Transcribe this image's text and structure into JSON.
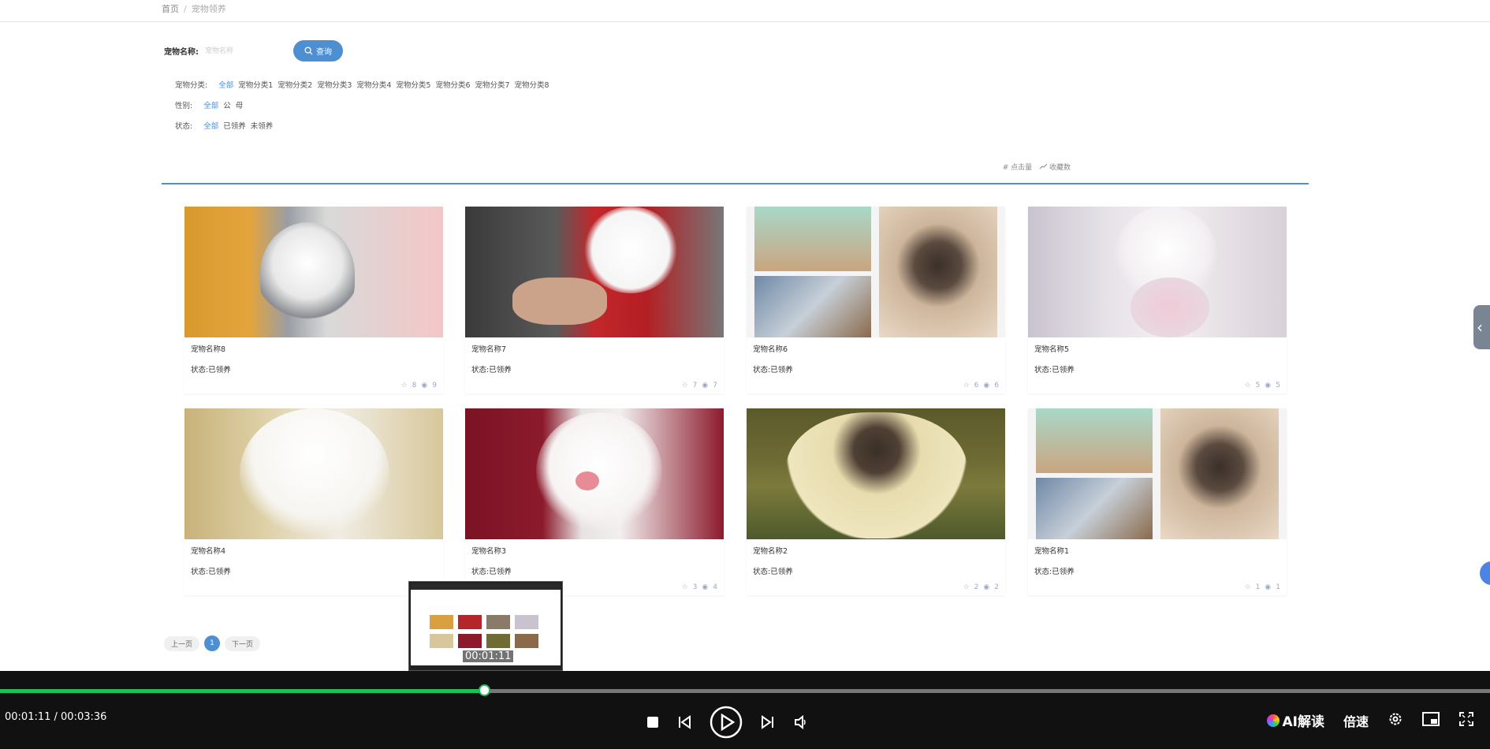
{
  "breadcrumb": {
    "home": "首页",
    "sep": "/",
    "current": "宠物领养"
  },
  "search": {
    "label": "宠物名称:",
    "placeholder": "宠物名称",
    "button": "查询"
  },
  "filters": {
    "category": {
      "label": "宠物分类:",
      "options": [
        "全部",
        "宠物分类1",
        "宠物分类2",
        "宠物分类3",
        "宠物分类4",
        "宠物分类5",
        "宠物分类6",
        "宠物分类7",
        "宠物分类8"
      ]
    },
    "gender": {
      "label": "性别:",
      "options": [
        "全部",
        "公",
        "母"
      ]
    },
    "status": {
      "label": "状态:",
      "options": [
        "全部",
        "已领养",
        "未领养"
      ]
    }
  },
  "sort": {
    "clicks": "# 点击量",
    "favorites": "收藏数"
  },
  "cards": [
    {
      "name": "宠物名称8",
      "status": "状态:已领养",
      "favorites": "8",
      "views": "9"
    },
    {
      "name": "宠物名称7",
      "status": "状态:已领养",
      "favorites": "7",
      "views": "7"
    },
    {
      "name": "宠物名称6",
      "status": "状态:已领养",
      "favorites": "6",
      "views": "6"
    },
    {
      "name": "宠物名称5",
      "status": "状态:已领养",
      "favorites": "5",
      "views": "5"
    },
    {
      "name": "宠物名称4",
      "status": "状态:已领养",
      "favorites": "",
      "views": ""
    },
    {
      "name": "宠物名称3",
      "status": "状态:已领养",
      "favorites": "3",
      "views": "4"
    },
    {
      "name": "宠物名称2",
      "status": "状态:已领养",
      "favorites": "2",
      "views": "2"
    },
    {
      "name": "宠物名称1",
      "status": "状态:已领养",
      "favorites": "1",
      "views": "1"
    }
  ],
  "pager": {
    "prev": "上一页",
    "page": "1",
    "next": "下一页"
  },
  "player": {
    "time": "00:01:11 / 00:03:36",
    "preview_time": "00:01:11",
    "progress": 0.325,
    "ai_label": "AI解读",
    "speed_label": "倍速",
    "colors": {
      "progress": "#1fbf5a",
      "accent": "#4d8fd0"
    }
  }
}
